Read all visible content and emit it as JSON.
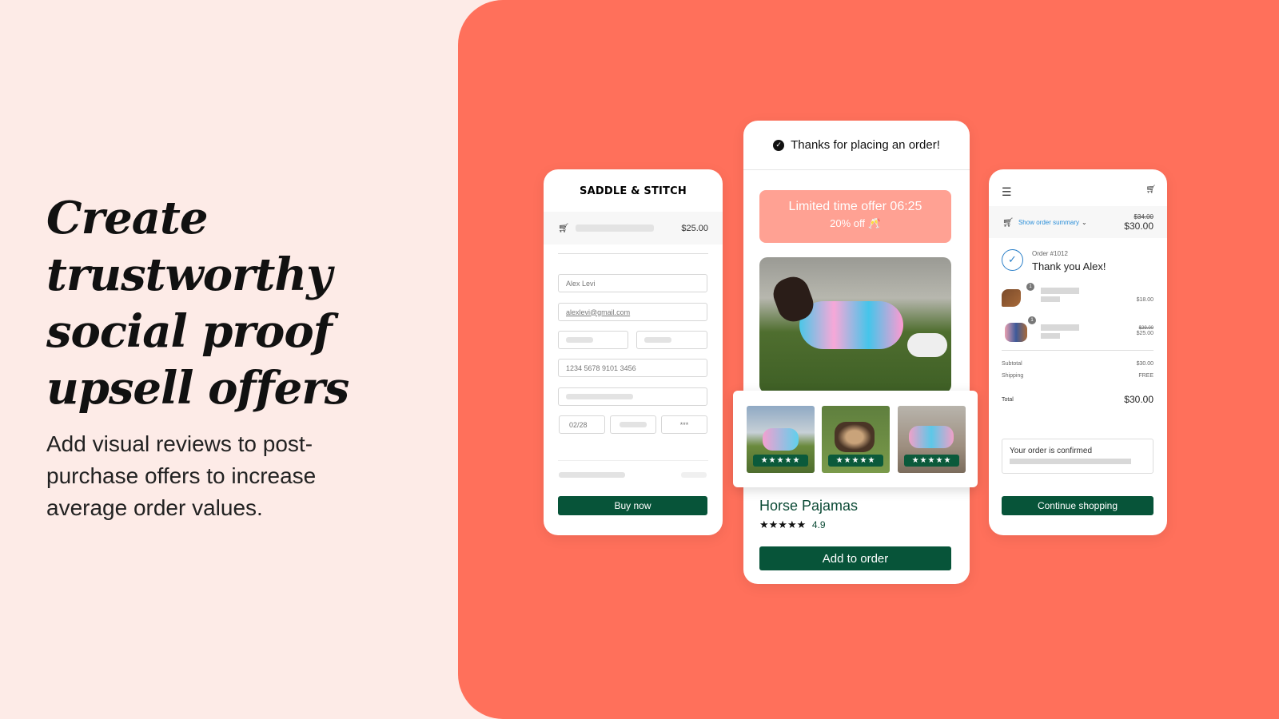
{
  "hero": {
    "headline": [
      "Create",
      "trustworthy",
      "social proof",
      "upsell offers"
    ],
    "subtitle": "Add visual reviews to post-purchase offers to increase average order values."
  },
  "checkout": {
    "brand": "SADDLE & STITCH",
    "total": "$25.00",
    "name": "Alex Levi",
    "email": "alexlevi@gmail.com",
    "card_number": "1234 5678 9101 3456",
    "expiry": "02/28",
    "cvv": "***",
    "buy_label": "Buy now"
  },
  "offer": {
    "thanks": "Thanks for placing an order!",
    "timer_text": "Limited time offer 06:25",
    "discount": "20% off 🥂",
    "reviews": [
      {
        "stars": "★★★★★"
      },
      {
        "stars": "★★★★★"
      },
      {
        "stars": "★★★★★"
      }
    ],
    "product_name": "Horse Pajamas",
    "rating_stars": "★★★★★",
    "rating": "4.9",
    "add_label": "Add to order"
  },
  "confirmation": {
    "summary_link": "Show order summary",
    "old_total": "$34.00",
    "total": "$30.00",
    "order_number": "Order #1012",
    "thanks": "Thank you Alex!",
    "items": [
      {
        "qty": "1",
        "price": "$18.00",
        "old_price": ""
      },
      {
        "qty": "1",
        "price": "$25.00",
        "old_price": "$29.00"
      }
    ],
    "subtotal_label": "Subtotal",
    "subtotal": "$30.00",
    "shipping_label": "Shipping",
    "shipping": "FREE",
    "total_label": "Total",
    "grand_total": "$30.00",
    "confirmed_text": "Your order is confirmed",
    "continue_label": "Continue shopping"
  },
  "colors": {
    "panel": "#ff705b",
    "background": "#fdebe7",
    "button": "#075439",
    "offer_banner": "#ffa193",
    "link": "#2a8ed8"
  }
}
